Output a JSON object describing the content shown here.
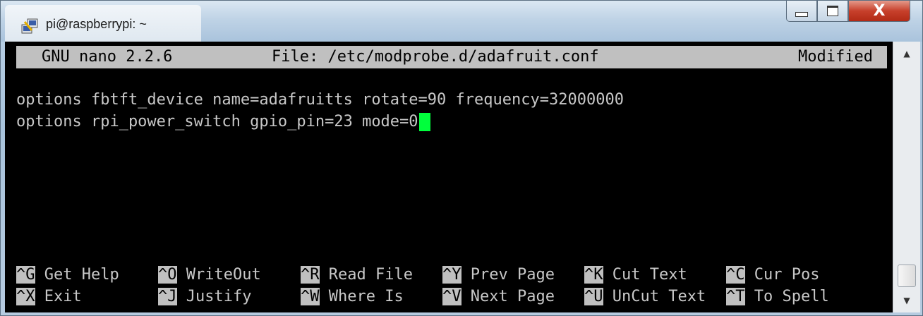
{
  "window": {
    "title": "pi@raspberrypi: ~",
    "close_glyph": "X"
  },
  "nano": {
    "version": "GNU nano 2.2.6",
    "file": "File: /etc/modprobe.d/adafruit.conf",
    "status": "Modified"
  },
  "editor": {
    "lines": [
      "options fbtft_device name=adafruitts rotate=90 frequency=32000000",
      "options rpi_power_switch gpio_pin=23 mode=0"
    ],
    "cursor_color": "#00ff3c"
  },
  "shortcuts": {
    "row1": [
      {
        "key": "^G",
        "label": " Get Help"
      },
      {
        "key": "^O",
        "label": " WriteOut"
      },
      {
        "key": "^R",
        "label": " Read File"
      },
      {
        "key": "^Y",
        "label": " Prev Page"
      },
      {
        "key": "^K",
        "label": " Cut Text"
      },
      {
        "key": "^C",
        "label": " Cur Pos"
      }
    ],
    "row2": [
      {
        "key": "^X",
        "label": " Exit"
      },
      {
        "key": "^J",
        "label": " Justify"
      },
      {
        "key": "^W",
        "label": " Where Is"
      },
      {
        "key": "^V",
        "label": " Next Page"
      },
      {
        "key": "^U",
        "label": " UnCut Text"
      },
      {
        "key": "^T",
        "label": " To Spell"
      }
    ]
  },
  "scrollbar": {
    "up_glyph": "▲",
    "down_glyph": "▼"
  },
  "colors": {
    "terminal_bg": "#000000",
    "terminal_fg": "#c8c8c8",
    "inverse_bg": "#c0c0c0",
    "close_button": "#c7402b"
  }
}
